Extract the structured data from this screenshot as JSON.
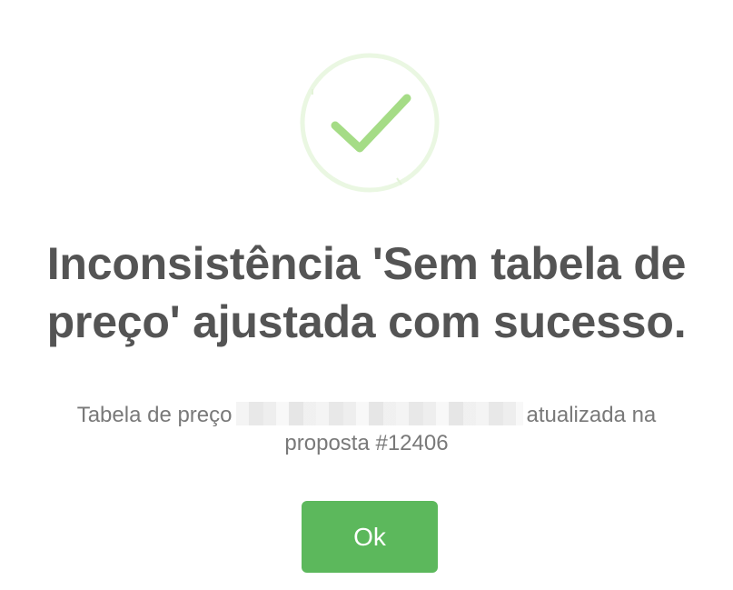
{
  "dialog": {
    "icon": "success-check-icon",
    "title": "Inconsistência 'Sem tabela de preço' ajustada com sucesso.",
    "message_prefix": "Tabela de preço",
    "message_suffix": "atualizada na proposta #12406",
    "ok_label": "Ok"
  },
  "colors": {
    "success_green": "#a5dc86",
    "success_ring": "#eaf7e2",
    "button_green": "#5cb85c",
    "title_text": "#545454",
    "body_text": "#797979"
  }
}
